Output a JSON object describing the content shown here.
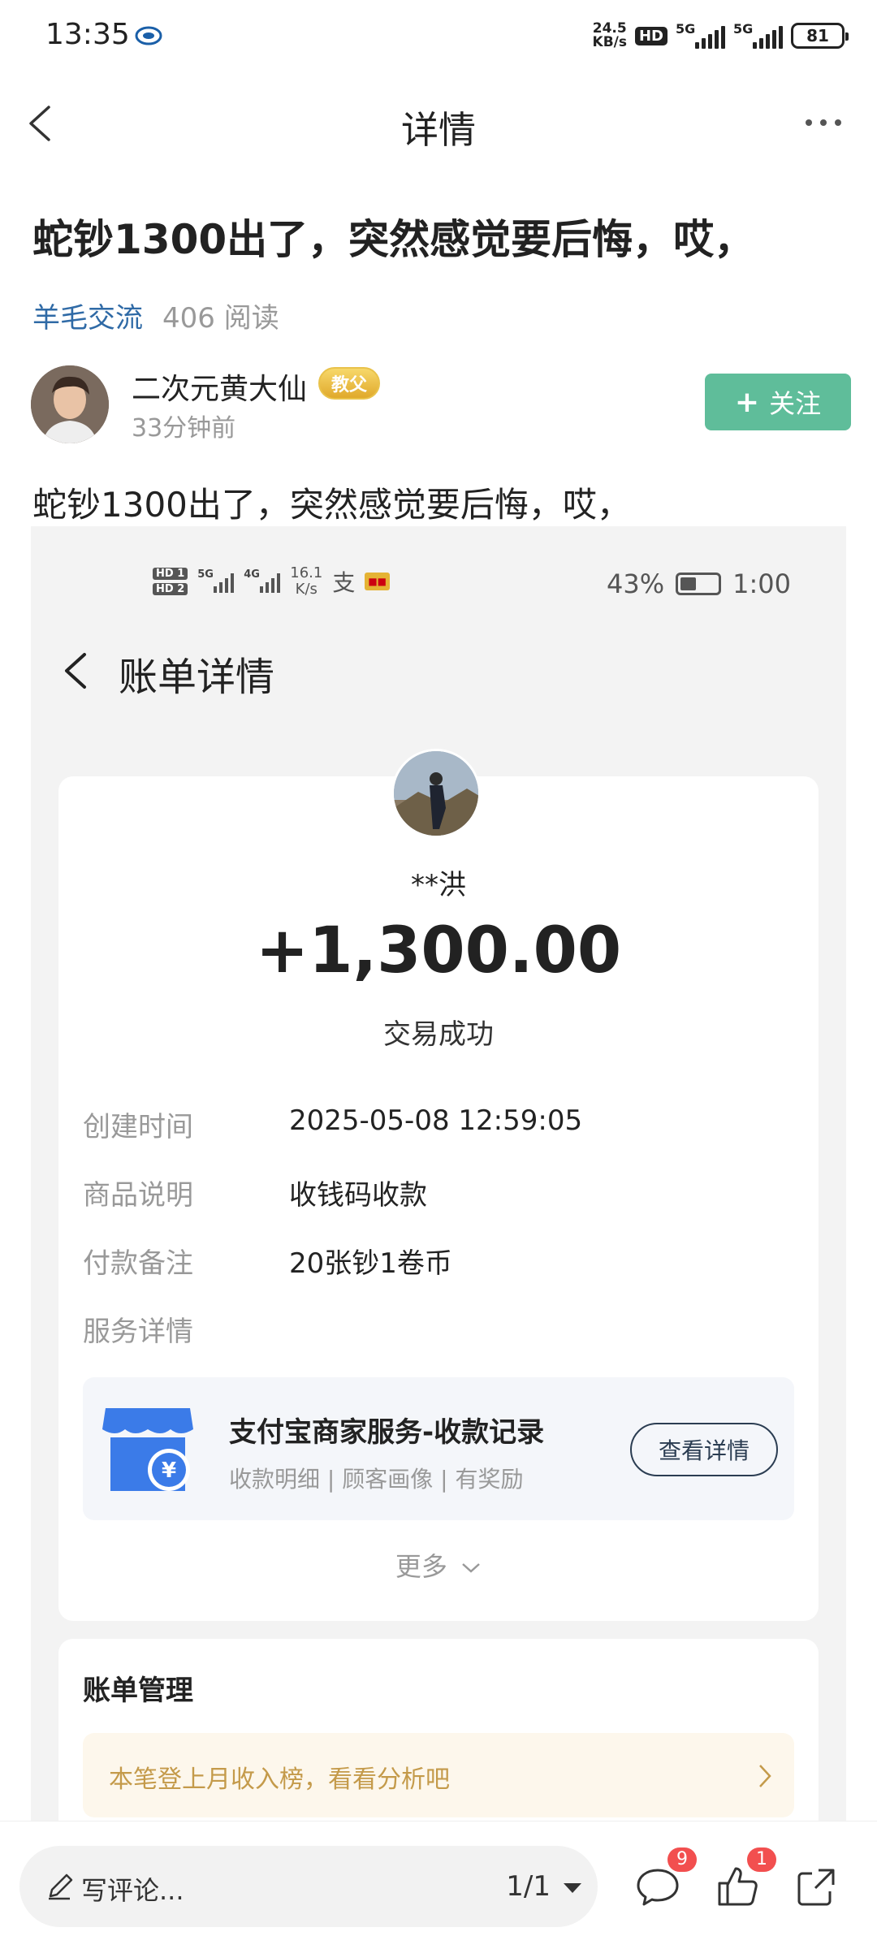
{
  "status_bar": {
    "time": "13:35",
    "net_speed_value": "24.5",
    "net_speed_unit": "KB/s",
    "hd_label": "HD",
    "sim1_type": "5G",
    "sim2_type": "5G",
    "battery": "81"
  },
  "header": {
    "title": "详情"
  },
  "post": {
    "title": "蛇钞1300出了，突然感觉要后悔，哎，",
    "topic": "羊毛交流",
    "reads": "406 阅读",
    "author_name": "二次元黄大仙",
    "author_badge": "教父",
    "post_time": "33分钟前",
    "follow_label": "关注",
    "body_text": "蛇钞1300出了，突然感觉要后悔，哎，"
  },
  "screenshot": {
    "status": {
      "hd1": "HD 1",
      "hd2": "HD 2",
      "sig1": "5G",
      "sig2": "4G",
      "speed_value": "16.1",
      "speed_unit": "K/s",
      "alipay_glyph": "支",
      "battery": "43%",
      "time": "1:00"
    },
    "bill_title": "账单详情",
    "payer_name": "**洪",
    "amount": "+1,300.00",
    "status_text": "交易成功",
    "rows": [
      {
        "label": "创建时间",
        "value": "2025-05-08 12:59:05"
      },
      {
        "label": "商品说明",
        "value": "收钱码收款"
      },
      {
        "label": "付款备注",
        "value": "20张钞1卷币"
      },
      {
        "label": "服务详情",
        "value": ""
      }
    ],
    "service": {
      "title": "支付宝商家服务-收款记录",
      "subtitle": "收款明细 | 顾客画像 | 有奖励",
      "button": "查看详情"
    },
    "more_label": "更多",
    "manage_title": "账单管理",
    "notice_text": "本笔登上月收入榜，看看分析吧"
  },
  "bottom_bar": {
    "comment_placeholder": "写评论...",
    "page_indicator": "1/1",
    "comment_count": "9",
    "like_count": "1"
  },
  "colors": {
    "follow_green": "#5fbd9a",
    "topic_blue": "#2f6aa6",
    "badge_red": "#f24f4f",
    "notice_gold": "#c49a4a"
  }
}
